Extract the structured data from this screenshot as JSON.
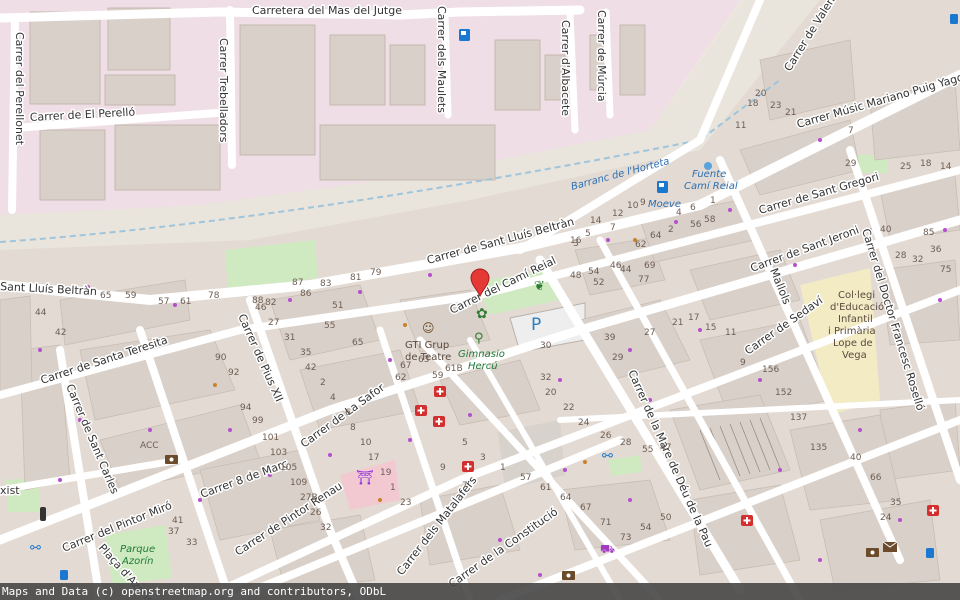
{
  "map": {
    "streets": [
      {
        "id": "mas-del-jutge",
        "text": "Carretera del Mas del Jutge"
      },
      {
        "id": "perellonet",
        "text": "Carrer del Perellonet"
      },
      {
        "id": "trebelladors",
        "text": "Carrer Trebelladors"
      },
      {
        "id": "maulets",
        "text": "Carrer dels Maulets"
      },
      {
        "id": "albacete",
        "text": "Carrer d'Albacete"
      },
      {
        "id": "murcia",
        "text": "Carrer de Múrcia"
      },
      {
        "id": "el-perello",
        "text": "Carrer de El Perelló"
      },
      {
        "id": "valencia",
        "text": "Carrer de Valencia"
      },
      {
        "id": "music-mariano",
        "text": "Carrer Músic Mariano Puig Yago"
      },
      {
        "id": "sant-gregori",
        "text": "Carrer de Sant Gregori"
      },
      {
        "id": "sant-lluis",
        "text": "Carrer de Sant Lluís Beltràn"
      },
      {
        "id": "sant-lluis-w",
        "text": "Sant Lluís Beltràn"
      },
      {
        "id": "cami-reial",
        "text": "Carrer del Camí Reial"
      },
      {
        "id": "sant-jeroni",
        "text": "Carrer de Sant Jeroni"
      },
      {
        "id": "mallols",
        "text": "Mallols"
      },
      {
        "id": "doctor-francesc",
        "text": "Carrer del Doctor Francesc Roselló"
      },
      {
        "id": "sedavi",
        "text": "Carrer de Sedaví"
      },
      {
        "id": "santa-teresita",
        "text": "Carrer de Santa Teresita"
      },
      {
        "id": "pius-xii",
        "text": "Carrer de Pius XII"
      },
      {
        "id": "sant-carles",
        "text": "Carrer de Sant Carles"
      },
      {
        "id": "la-safor",
        "text": "Carrer de La Safor"
      },
      {
        "id": "mare-de-deu",
        "text": "Carrer de la Mare de Déu de la Pau"
      },
      {
        "id": "8-de-marc",
        "text": "Carrer 8 de Març"
      },
      {
        "id": "pintor-renau",
        "text": "Carrer de Pintor Renau"
      },
      {
        "id": "pintor-miro",
        "text": "Carrer del Pintor Miró"
      },
      {
        "id": "matalafers",
        "text": "Carrer dels Matalafers"
      },
      {
        "id": "constitucio",
        "text": "Carrer de la Constitució"
      },
      {
        "id": "placa",
        "text": "Plaça d'Azorín"
      },
      {
        "id": "xist",
        "text": "xist"
      }
    ],
    "labels": {
      "barranc": "Barranc de l'Horteta",
      "fuente_1": "Fuente",
      "fuente_2": "Camí Reial",
      "moeve": "Moeve",
      "gti_1": "GTI Grup",
      "gti_2": "de Teatre",
      "gym_1": "Gimnasio",
      "gym_2": "Hercú",
      "parque_1": "Parque",
      "parque_2": "Azorín",
      "school_1": "Col·legi",
      "school_2": "d'Educació",
      "school_3": "Infantil",
      "school_4": "i Primària",
      "school_5": "Lope de",
      "school_6": "Vega",
      "acc": "ACC",
      "parking": "P"
    },
    "house_numbers": [
      "16",
      "14",
      "12",
      "10",
      "9",
      "7",
      "5",
      "3",
      "1",
      "6",
      "4",
      "2",
      "64",
      "62",
      "58",
      "56",
      "54",
      "52",
      "48",
      "46",
      "44",
      "69",
      "77",
      "81",
      "79",
      "83",
      "87",
      "51",
      "55",
      "65",
      "67",
      "61B",
      "59",
      "62",
      "63",
      "30",
      "32",
      "20",
      "22",
      "24",
      "26",
      "28",
      "55",
      "47",
      "39",
      "29",
      "27",
      "21",
      "17",
      "15",
      "11",
      "9",
      "156",
      "152",
      "137",
      "135",
      "40",
      "66",
      "35",
      "24",
      "20",
      "18",
      "23",
      "21",
      "11",
      "7",
      "29",
      "25",
      "18",
      "14",
      "40",
      "85",
      "75",
      "36",
      "32",
      "28",
      "44",
      "42",
      "65",
      "59",
      "57",
      "61",
      "78",
      "82",
      "86",
      "88",
      "90",
      "92",
      "94",
      "99",
      "101",
      "103",
      "105",
      "109",
      "27B",
      "26",
      "32",
      "41",
      "37",
      "33",
      "23",
      "1",
      "19",
      "17",
      "10",
      "8",
      "6",
      "4",
      "2",
      "42",
      "35",
      "31",
      "27",
      "46",
      "50",
      "54",
      "73",
      "71",
      "67",
      "64",
      "61",
      "57",
      "1",
      "3",
      "5",
      "7",
      "9"
    ],
    "icons": [
      "fuel-icon",
      "fuel-icon",
      "water-icon",
      "marker-icon",
      "dog-park-icon",
      "tree-icon",
      "parking-icon",
      "fitness-icon",
      "theatre-icon",
      "pharmacy-icon",
      "pharmacy-icon",
      "pharmacy-icon",
      "pharmacy-icon",
      "pharmacy-icon",
      "bicycle-icon",
      "bicycle-icon",
      "bus-icon",
      "bus-icon",
      "shop-icon",
      "post-icon",
      "bank-icon",
      "playground-icon",
      "atm-icon"
    ]
  },
  "attribution": "Maps and Data (c) openstreetmap.org and contributors, ODbL"
}
